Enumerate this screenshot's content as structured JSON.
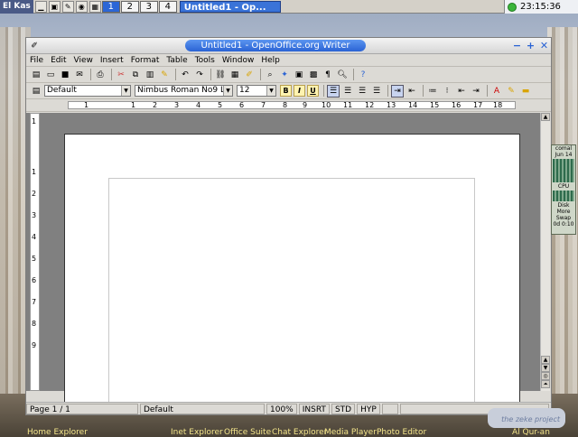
{
  "panel": {
    "menu_label": "El Kas",
    "workspaces": [
      "1",
      "2",
      "3",
      "4"
    ],
    "active_workspace": "1",
    "task_title": "Untitled1 - Op...",
    "clock": "23:15:36"
  },
  "window": {
    "title": "Untitled1 - OpenOffice.org Writer",
    "menu": [
      "File",
      "Edit",
      "View",
      "Insert",
      "Format",
      "Table",
      "Tools",
      "Window",
      "Help"
    ],
    "style_value": "Default",
    "font_value": "Nimbus Roman No9 L",
    "size_value": "12",
    "bold_label": "B",
    "italic_label": "I",
    "underline_label": "U",
    "ruler_numbers": [
      "1",
      "1",
      "2",
      "3",
      "4",
      "5",
      "6",
      "7",
      "8",
      "9",
      "10",
      "11",
      "12",
      "13",
      "14",
      "15",
      "16",
      "17",
      "18"
    ],
    "vruler_numbers": [
      "1",
      "1",
      "2",
      "3",
      "4",
      "5",
      "6",
      "7",
      "8",
      "9"
    ],
    "status": {
      "page": "Page 1 / 1",
      "style": "Default",
      "zoom": "100%",
      "insert": "INSRT",
      "sel": "STD",
      "hyp": "HYP"
    }
  },
  "monitor": {
    "title": "comal",
    "date": "Jun 14",
    "cpu": "CPU",
    "disk": "Disk",
    "more": "More",
    "swap": "Swap",
    "uptime": "0d 0:10"
  },
  "dock": {
    "items": [
      "Home Explorer",
      "Inet Explorer",
      "Office Suite",
      "Chat Explorer",
      "Media Player",
      "Photo Editor",
      "Al Qur-an"
    ]
  },
  "branding": {
    "zeke": "the zeke project"
  }
}
